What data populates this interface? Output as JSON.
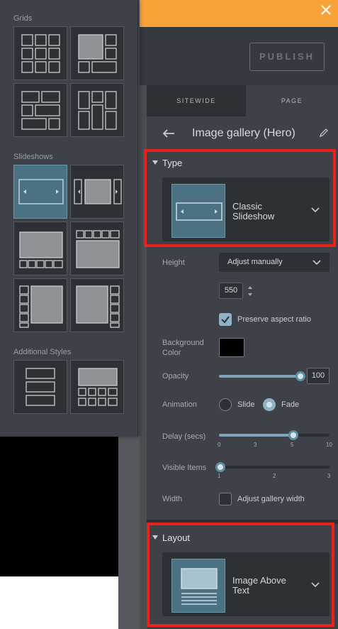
{
  "toolbar": {
    "publish_label": "PUBLISH"
  },
  "panel": {
    "tabs": [
      {
        "label": "SITEWIDE"
      },
      {
        "label": "PAGE"
      }
    ],
    "title": "Image gallery (Hero)",
    "type_section": {
      "label": "Type",
      "selected_line1": "Classic",
      "selected_line2": "Slideshow"
    },
    "height": {
      "label": "Height",
      "mode": "Adjust manually",
      "value": "550"
    },
    "preserve_aspect": {
      "label": "Preserve aspect ratio",
      "checked": true
    },
    "background_color": {
      "label_line1": "Background",
      "label_line2": "Color",
      "value": "#000000"
    },
    "opacity": {
      "label": "Opacity",
      "value": "100",
      "fraction": 1.0
    },
    "animation": {
      "label": "Animation",
      "options": [
        "Slide",
        "Fade"
      ],
      "selected": "Fade"
    },
    "delay": {
      "label": "Delay (secs)",
      "ticks": [
        "0",
        "3",
        "5",
        "10"
      ],
      "value": 5
    },
    "visible_items": {
      "label": "Visible Items",
      "ticks": [
        "1",
        "2",
        "3"
      ],
      "value": 1
    },
    "width": {
      "label": "Width",
      "option_label": "Adjust gallery width",
      "checked": false
    },
    "layout_section": {
      "label": "Layout",
      "selected_line1": "Image Above",
      "selected_line2": "Text"
    }
  },
  "style_picker": {
    "groups": [
      {
        "heading": "Grids",
        "count": 4
      },
      {
        "heading": "Slideshows",
        "count": 6,
        "selected_index": 0
      },
      {
        "heading": "Additional Styles",
        "count": 2
      }
    ]
  },
  "colors": {
    "accent_orange": "#f7a33a",
    "highlight_red": "#e8231b",
    "selected_teal": "#4a7282"
  },
  "icons": [
    "close-icon",
    "back-arrow-icon",
    "pencil-icon",
    "chevron-down-icon",
    "check-icon"
  ]
}
